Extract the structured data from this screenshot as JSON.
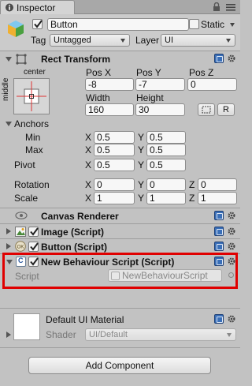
{
  "tab": {
    "label": "Inspector"
  },
  "header": {
    "object_name": "Button",
    "static_label": "Static",
    "tag_label": "Tag",
    "tag_value": "Untagged",
    "layer_label": "Layer",
    "layer_value": "UI"
  },
  "rect_transform": {
    "title": "Rect Transform",
    "anchor_preset_top": "center",
    "anchor_preset_side": "middle",
    "pos_x_label": "Pos X",
    "pos_y_label": "Pos Y",
    "pos_z_label": "Pos Z",
    "pos_x": "-8",
    "pos_y": "-7",
    "pos_z": "0",
    "width_label": "Width",
    "height_label": "Height",
    "width": "160",
    "height": "30",
    "raw_button_label": "R",
    "anchors_label": "Anchors",
    "min_label": "Min",
    "max_label": "Max",
    "anchor_min_x": "0.5",
    "anchor_min_y": "0.5",
    "anchor_max_x": "0.5",
    "anchor_max_y": "0.5",
    "pivot_label": "Pivot",
    "pivot_x": "0.5",
    "pivot_y": "0.5",
    "rotation_label": "Rotation",
    "rotation_x": "0",
    "rotation_y": "0",
    "rotation_z": "0",
    "scale_label": "Scale",
    "scale_x": "1",
    "scale_y": "1",
    "scale_z": "1",
    "axis_x": "X",
    "axis_y": "Y",
    "axis_z": "Z"
  },
  "canvas_renderer": {
    "title": "Canvas Renderer"
  },
  "image_script": {
    "title": "Image (Script)"
  },
  "button_script": {
    "title": "Button (Script)"
  },
  "behaviour_script": {
    "title": "New Behaviour Script (Script)",
    "script_label": "Script",
    "script_value": "NewBehaviourScript"
  },
  "material": {
    "title": "Default UI Material",
    "shader_label": "Shader",
    "shader_value": "UI/Default"
  },
  "add_component_label": "Add Component",
  "colors": {
    "highlight_border": "#e00000",
    "panel_bg": "#c2c2c2",
    "help_icon": "#3a6fb8"
  }
}
